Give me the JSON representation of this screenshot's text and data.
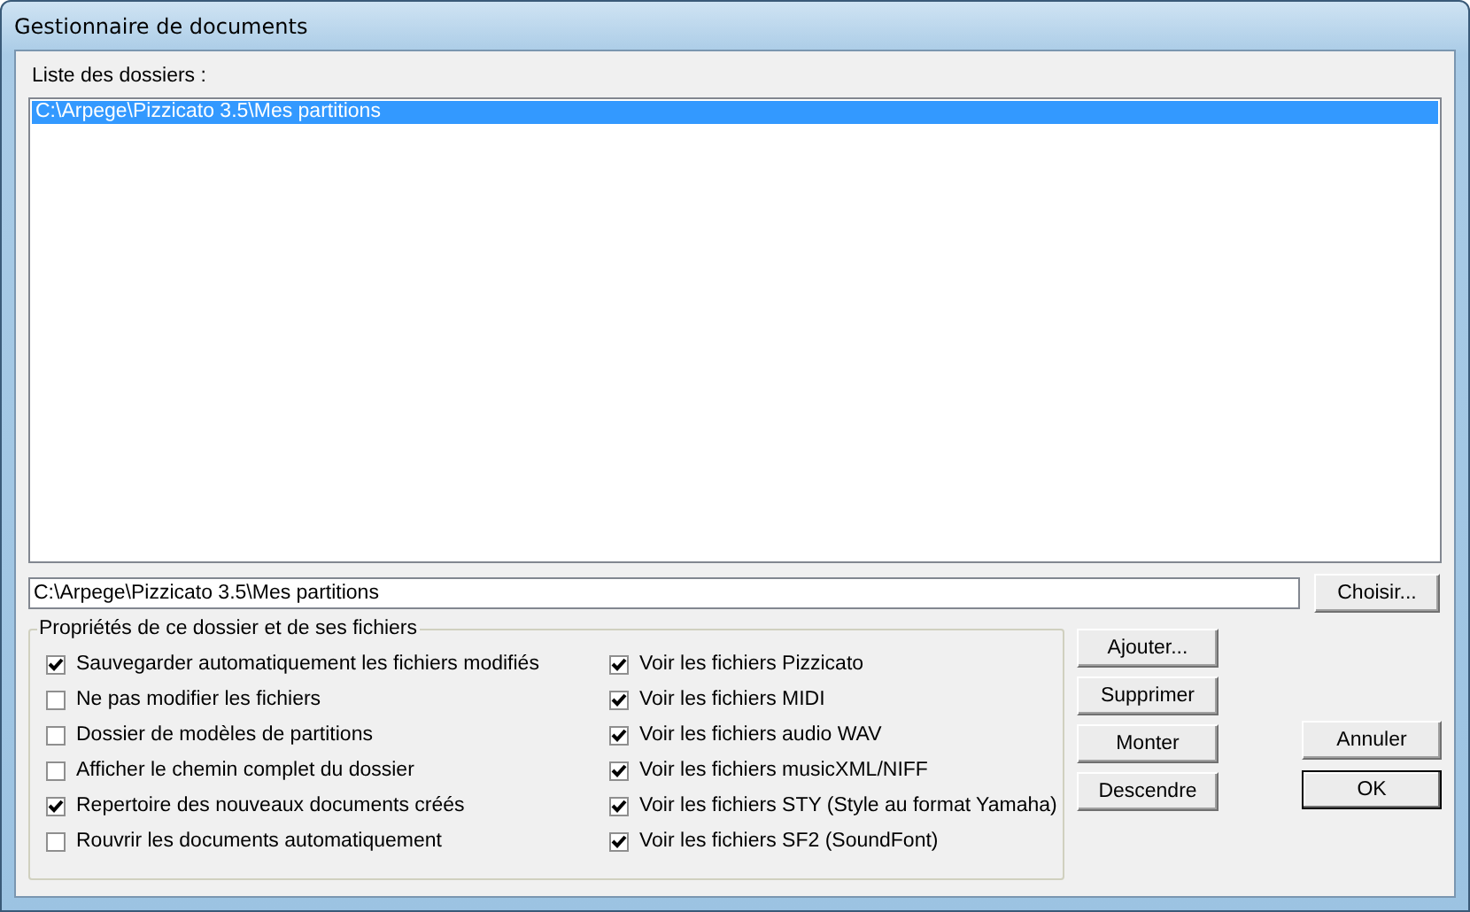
{
  "window": {
    "title": "Gestionnaire de documents"
  },
  "folder_list": {
    "label": "Liste des dossiers :",
    "items": [
      {
        "text": "C:\\Arpege\\Pizzicato 3.5\\Mes partitions",
        "selected": true
      }
    ]
  },
  "path_field": {
    "value": "C:\\Arpege\\Pizzicato 3.5\\Mes partitions"
  },
  "choose_button": "Choisir...",
  "properties": {
    "title": "Propriétés de ce dossier et de ses fichiers",
    "left_options": [
      {
        "label": "Sauvegarder automatiquement les fichiers modifiés",
        "checked": true
      },
      {
        "label": "Ne pas modifier les fichiers",
        "checked": false
      },
      {
        "label": "Dossier de modèles de partitions",
        "checked": false
      },
      {
        "label": "Afficher le chemin complet du dossier",
        "checked": false
      },
      {
        "label": "Repertoire des nouveaux documents créés",
        "checked": true
      },
      {
        "label": "Rouvrir les documents automatiquement",
        "checked": false
      }
    ],
    "right_options": [
      {
        "label": "Voir les fichiers Pizzicato",
        "checked": true
      },
      {
        "label": "Voir les fichiers MIDI",
        "checked": true
      },
      {
        "label": "Voir les fichiers audio WAV",
        "checked": true
      },
      {
        "label": "Voir les fichiers musicXML/NIFF",
        "checked": true
      },
      {
        "label": "Voir les fichiers STY (Style au format Yamaha)",
        "checked": true
      },
      {
        "label": "Voir les fichiers SF2 (SoundFont)",
        "checked": true
      }
    ]
  },
  "list_buttons": [
    "Ajouter...",
    "Supprimer",
    "Monter",
    "Descendre"
  ],
  "dialog_buttons": [
    {
      "label": "Annuler",
      "default": false
    },
    {
      "label": "OK",
      "default": true
    }
  ]
}
